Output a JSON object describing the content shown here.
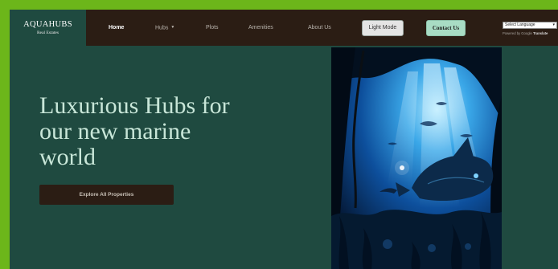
{
  "brand": {
    "name": "AQUAHUBS",
    "subtitle": "Real Estates"
  },
  "nav": {
    "items": [
      {
        "label": "Home",
        "active": true
      },
      {
        "label": "Hubs",
        "has_dropdown": true
      },
      {
        "label": "Plots"
      },
      {
        "label": "Amenities"
      },
      {
        "label": "About Us"
      }
    ],
    "light_mode_label": "Light Mode",
    "contact_label": "Contact Us"
  },
  "translate": {
    "select_value": "Select Language",
    "powered_prefix": "Powered by Google",
    "powered_brand": "Translate"
  },
  "hero": {
    "title_lines": [
      "Luxurious Hubs for",
      "our new marine",
      "world"
    ],
    "cta_label": "Explore All Properties",
    "image_icon": "underwater-scene-illustration"
  },
  "colors": {
    "page_outer": "#6cb61a",
    "background": "#1f4a40",
    "navbar": "#2b1d14",
    "title_text": "#c8e6d8",
    "contact_button": "#a8dcc4",
    "light_mode_button": "#e4e4e4"
  }
}
